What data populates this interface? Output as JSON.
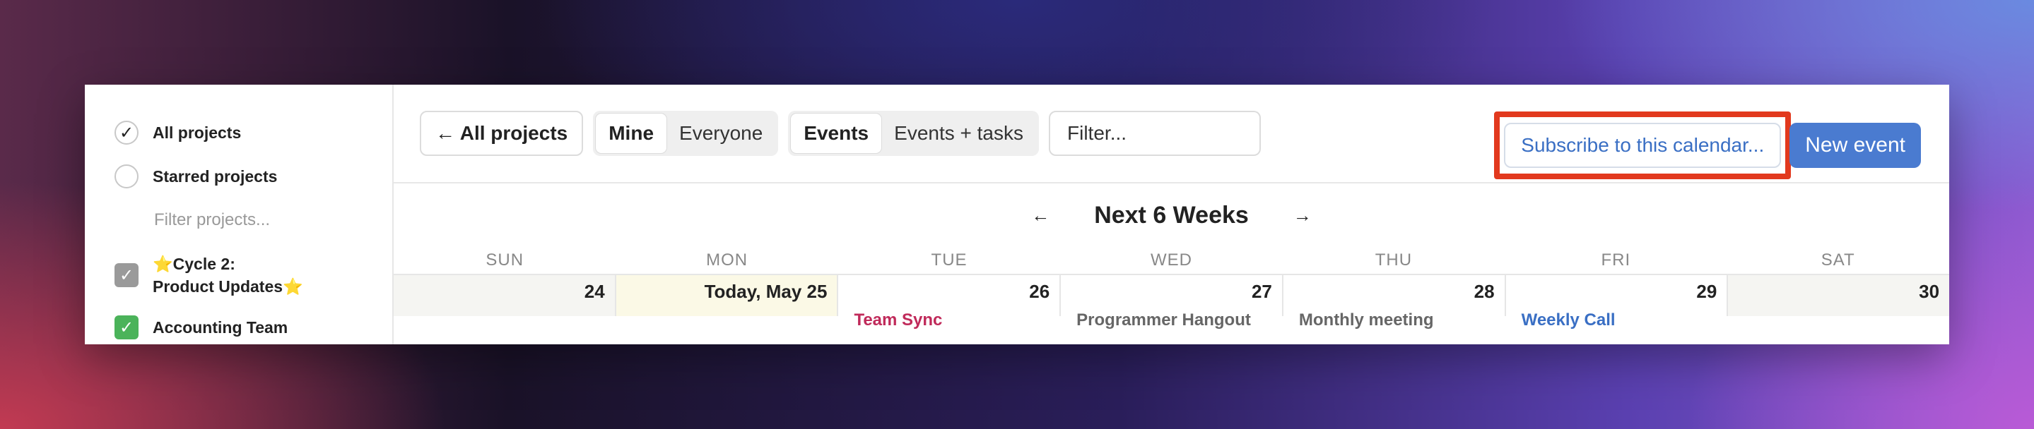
{
  "sidebar": {
    "items": [
      {
        "label": "All projects",
        "checked": true
      },
      {
        "label": "Starred projects",
        "checked": false
      }
    ],
    "filter_placeholder": "Filter projects...",
    "projects": [
      {
        "line1": "⭐Cycle 2:",
        "line2": "Product Updates⭐",
        "color": "#9a9a9a"
      },
      {
        "label": "Accounting Team",
        "color": "#4bb35a"
      }
    ]
  },
  "toolbar": {
    "back_label": "← All projects",
    "scope": {
      "mine": "Mine",
      "everyone": "Everyone"
    },
    "kind": {
      "events": "Events",
      "events_tasks": "Events + tasks"
    },
    "filter_placeholder": "Filter...",
    "subscribe_label": "Subscribe to this calendar...",
    "new_event_label": "New event",
    "highlight_color": "#e2391e",
    "accent_color": "#4a7bd0"
  },
  "range": {
    "prev": "←",
    "title": "Next 6 Weeks",
    "next": "→"
  },
  "weekdays": [
    "SUN",
    "MON",
    "TUE",
    "WED",
    "THU",
    "FRI",
    "SAT"
  ],
  "days": [
    {
      "label": "24"
    },
    {
      "label": "Today, May 25"
    },
    {
      "label": "26",
      "event": "Team Sync",
      "event_color": "#c02a5a"
    },
    {
      "label": "27",
      "event": "Programmer Hangout",
      "event_color": "#666666"
    },
    {
      "label": "28",
      "event": "Monthly meeting",
      "event_color": "#666666"
    },
    {
      "label": "29",
      "event": "Weekly Call",
      "event_color": "#3a6fc4"
    },
    {
      "label": "30"
    }
  ]
}
